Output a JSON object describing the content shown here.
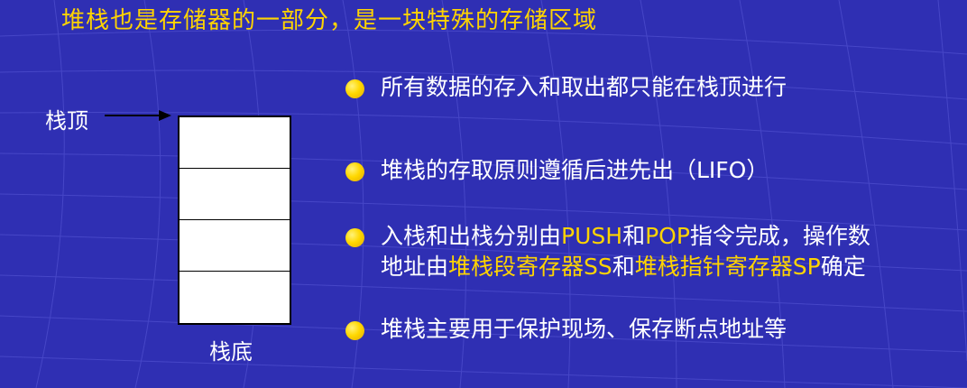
{
  "title": "堆栈也是存储器的一部分，是一块特殊的存储区域",
  "diagram": {
    "top_label": "栈顶",
    "bottom_label": "栈底"
  },
  "bullets": [
    {
      "text": "所有数据的存入和取出都只能在栈顶进行"
    },
    {
      "text": "堆栈的存取原则遵循后进先出（LIFO）"
    },
    {
      "line1_part1": "入栈和出栈分别由",
      "line1_hl1": "PUSH",
      "line1_part2": "和",
      "line1_hl2": "POP",
      "line1_part3": "指令完成，操作数",
      "line2_part1": "地址由",
      "line2_hl1": "堆栈段寄存器SS",
      "line2_part2": "和",
      "line2_hl2": "堆栈指针寄存器SP",
      "line2_part3": "确定"
    },
    {
      "text": "堆栈主要用于保护现场、保存断点地址等"
    }
  ],
  "colors": {
    "background": "#2f2fb3",
    "highlight": "#ffd400",
    "text": "#ffffff"
  }
}
